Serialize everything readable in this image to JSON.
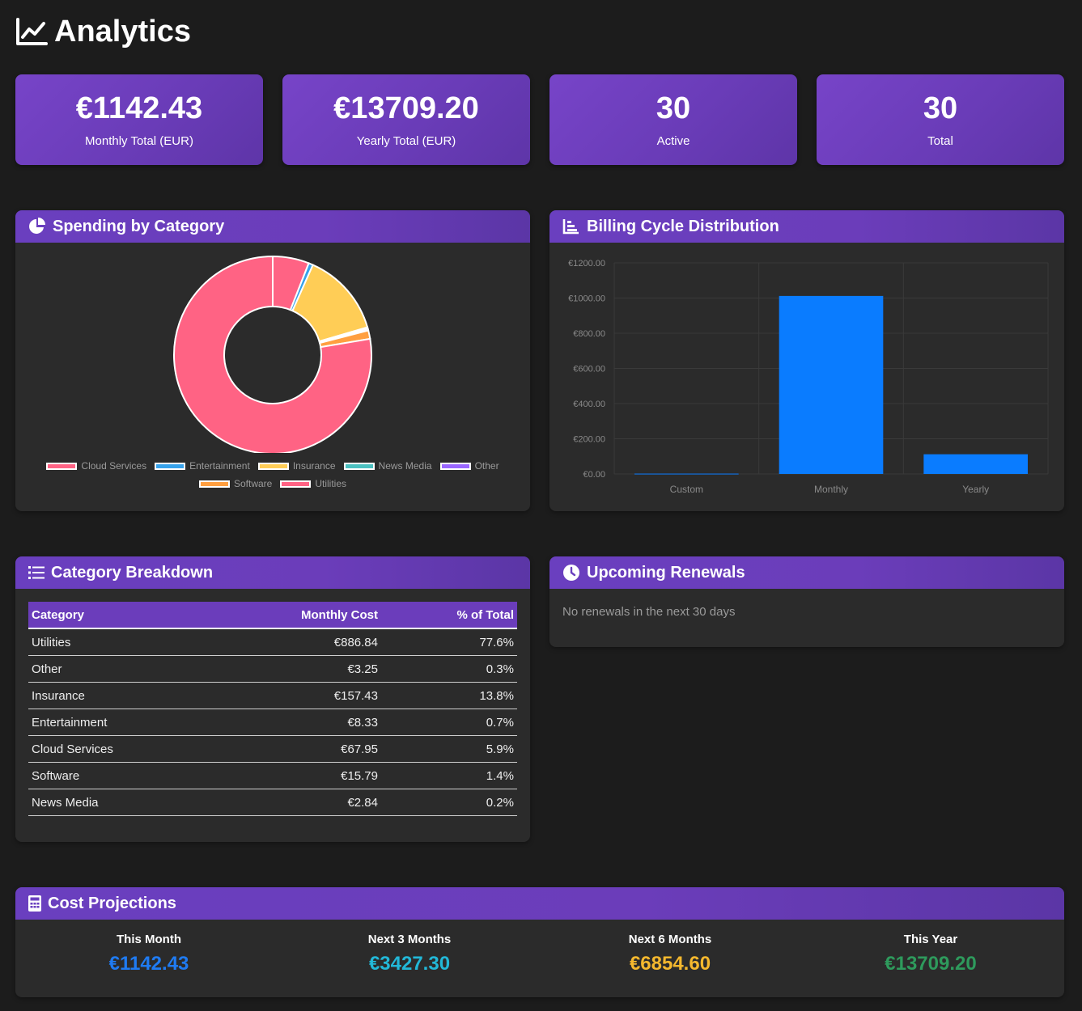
{
  "page": {
    "title": "Analytics"
  },
  "stats": [
    {
      "value": "€1142.43",
      "label": "Monthly Total (EUR)"
    },
    {
      "value": "€13709.20",
      "label": "Yearly Total (EUR)"
    },
    {
      "value": "30",
      "label": "Active"
    },
    {
      "value": "30",
      "label": "Total"
    }
  ],
  "spending": {
    "title": "Spending by Category",
    "chart_data": {
      "type": "pie",
      "categories": [
        "Cloud Services",
        "Entertainment",
        "Insurance",
        "News Media",
        "Other",
        "Software",
        "Utilities"
      ],
      "values": [
        67.95,
        8.33,
        157.43,
        2.84,
        3.25,
        15.79,
        886.84
      ],
      "colors": [
        "#ff6384",
        "#36a2eb",
        "#ffcd56",
        "#4bc0c0",
        "#9966ff",
        "#ff9f40",
        "#ff6384"
      ],
      "legend": "bottom"
    }
  },
  "billing": {
    "title": "Billing Cycle Distribution",
    "chart_data": {
      "type": "bar",
      "categories": [
        "Custom",
        "Monthly",
        "Yearly"
      ],
      "values": [
        2,
        1012,
        112
      ],
      "ylim": [
        0,
        1200
      ],
      "yticks": [
        "€0.00",
        "€200.00",
        "€400.00",
        "€600.00",
        "€800.00",
        "€1000.00",
        "€1200.00"
      ],
      "ytick_values": [
        0,
        200,
        400,
        600,
        800,
        1000,
        1200
      ],
      "color": "#0a7cff",
      "grid": true
    }
  },
  "breakdown": {
    "title": "Category Breakdown",
    "headers": [
      "Category",
      "Monthly Cost",
      "% of Total"
    ],
    "rows": [
      [
        "Utilities",
        "€886.84",
        "77.6%"
      ],
      [
        "Other",
        "€3.25",
        "0.3%"
      ],
      [
        "Insurance",
        "€157.43",
        "13.8%"
      ],
      [
        "Entertainment",
        "€8.33",
        "0.7%"
      ],
      [
        "Cloud Services",
        "€67.95",
        "5.9%"
      ],
      [
        "Software",
        "€15.79",
        "1.4%"
      ],
      [
        "News Media",
        "€2.84",
        "0.2%"
      ]
    ]
  },
  "renewals": {
    "title": "Upcoming Renewals",
    "empty_text": "No renewals in the next 30 days"
  },
  "projections": {
    "title": "Cost Projections",
    "items": [
      {
        "label": "This Month",
        "value": "€1142.43",
        "color": "#1f7bf2"
      },
      {
        "label": "Next 3 Months",
        "value": "€3427.30",
        "color": "#22b8d8"
      },
      {
        "label": "Next 6 Months",
        "value": "€6854.60",
        "color": "#f5b82e"
      },
      {
        "label": "This Year",
        "value": "€13709.20",
        "color": "#2e9a5c"
      }
    ]
  }
}
